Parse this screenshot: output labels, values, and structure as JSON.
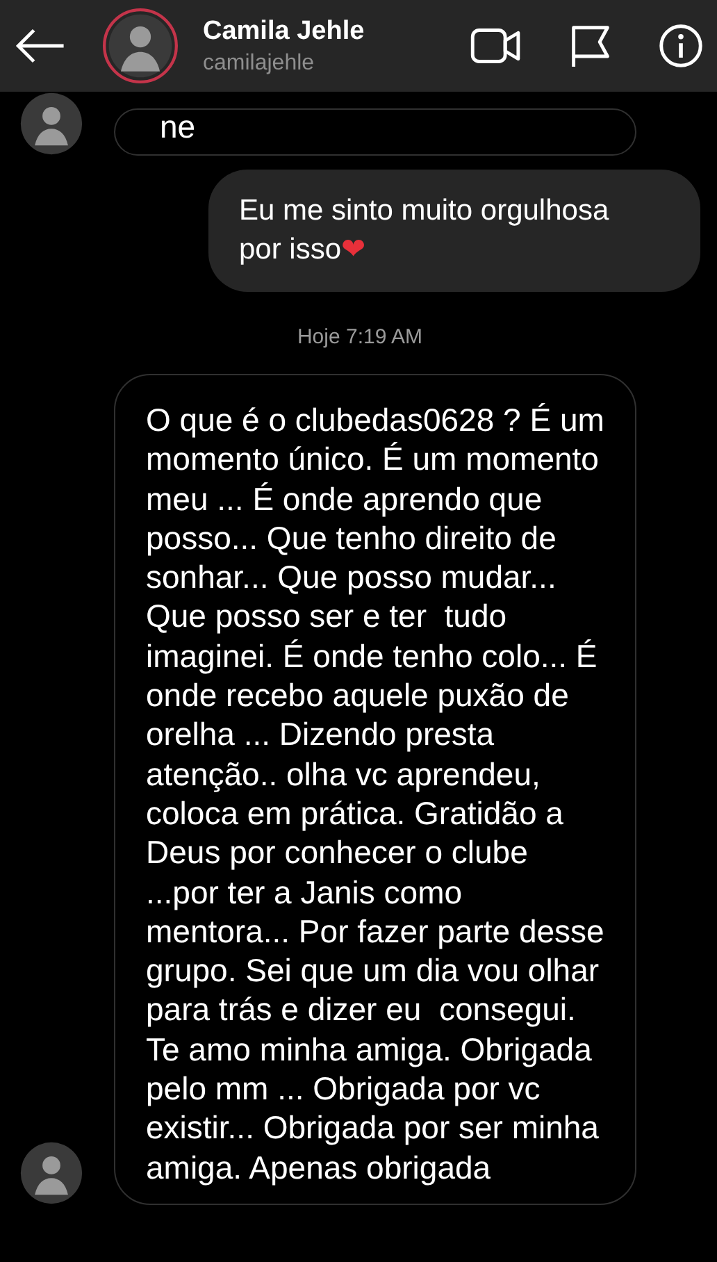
{
  "header": {
    "name": "Camila Jehle",
    "username": "camilajehle",
    "story_ring": true
  },
  "messages": [
    {
      "kind": "received",
      "text": "ne",
      "show_avatar": true
    },
    {
      "kind": "sent",
      "text": "Eu me sinto muito orgulhosa por isso",
      "emoji": "❤"
    },
    {
      "kind": "timestamp",
      "text": "Hoje 7:19 AM"
    },
    {
      "kind": "received",
      "text": "O que é o clubedas0628 ? É um momento único. É um momento meu ... É onde aprendo que posso... Que tenho direito de sonhar... Que posso mudar... Que posso ser e ter  tudo imaginei. É onde tenho colo... É onde recebo aquele puxão de orelha ... Dizendo presta atenção.. olha vc aprendeu, coloca em prática. Gratidão a Deus por conhecer o clube ...por ter a Janis como mentora... Por fazer parte desse grupo. Sei que um dia vou olhar para trás e dizer eu  consegui. Te amo minha amiga. Obrigada pelo mm ... Obrigada por vc existir... Obrigada por ser minha amiga. Apenas obrigada",
      "show_avatar": true
    }
  ]
}
